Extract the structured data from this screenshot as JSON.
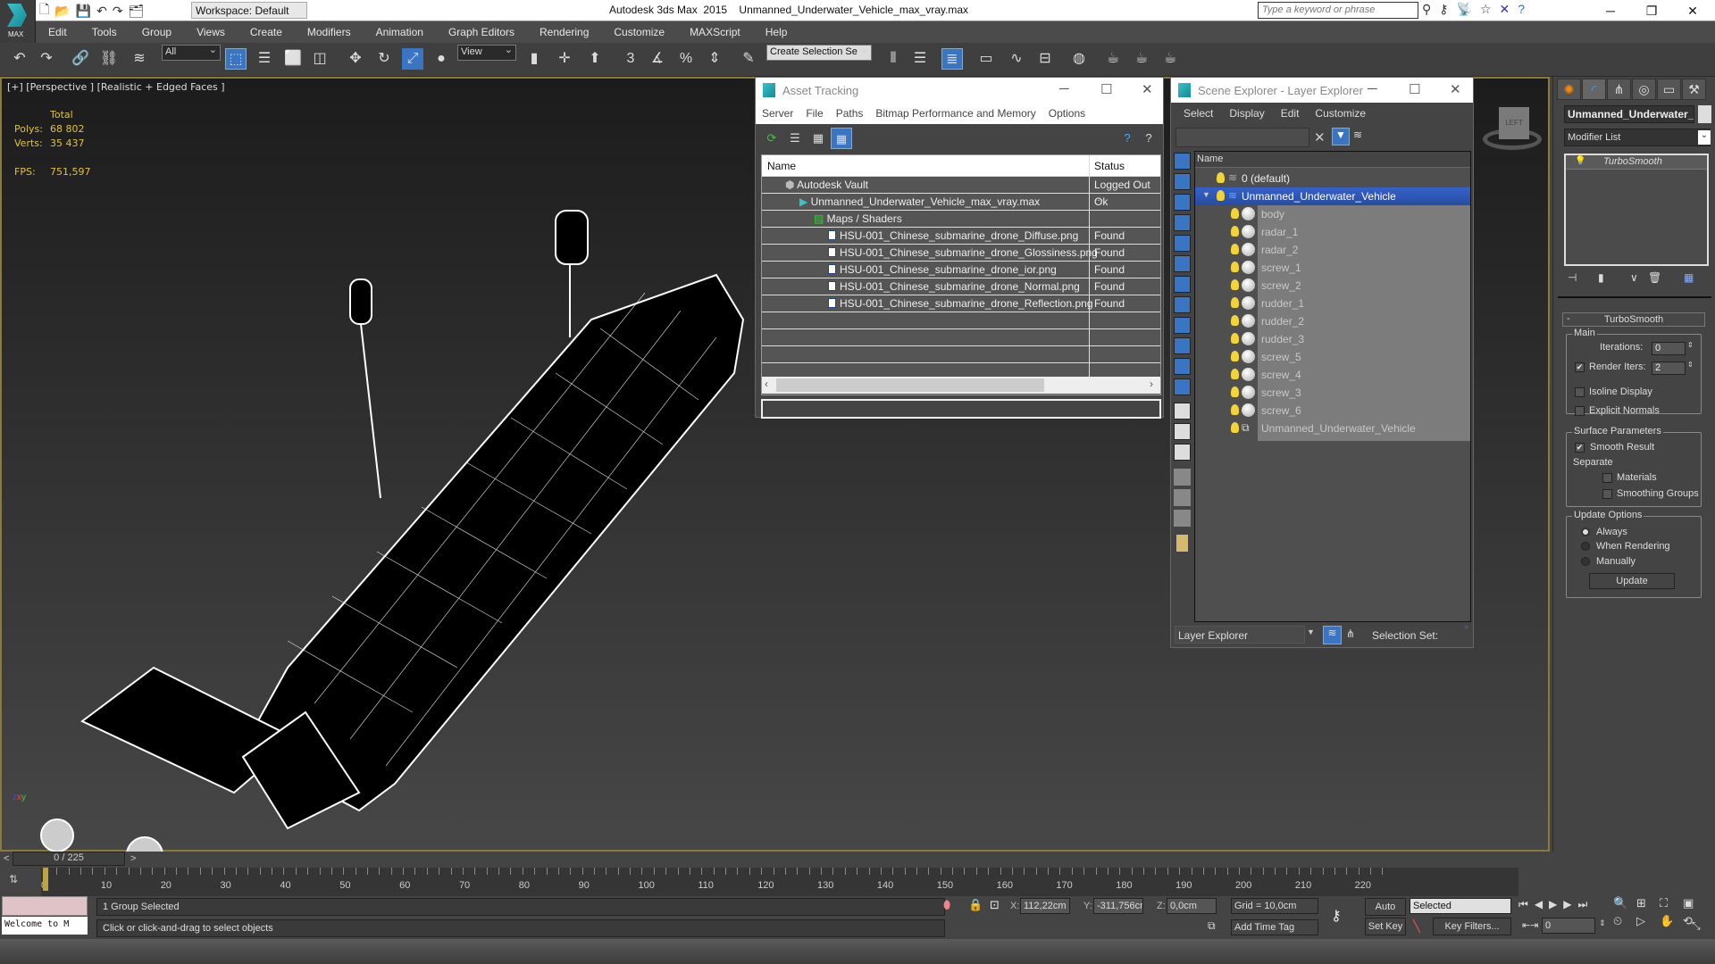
{
  "app": {
    "title": "Autodesk 3ds Max  2015    Unmanned_Underwater_Vehicle_max_vray.max",
    "logo_label": "MAX",
    "workspace": "Workspace: Default",
    "search_placeholder": "Type a keyword or phrase"
  },
  "menu": [
    "Edit",
    "Tools",
    "Group",
    "Views",
    "Create",
    "Modifiers",
    "Animation",
    "Graph Editors",
    "Rendering",
    "Customize",
    "MAXScript",
    "Help"
  ],
  "toolbar": {
    "filter_select": "All",
    "ref_coord": "View",
    "selection_set": "Create Selection Se"
  },
  "viewport": {
    "label": "[+] [Perspective ] [Realistic + Edged Faces ]",
    "stats_header": "Total",
    "polys_label": "Polys:",
    "polys": "68 802",
    "verts_label": "Verts:",
    "verts": "35 437",
    "fps_label": "FPS:",
    "fps": "751,597",
    "viewcube_face": "LEFT"
  },
  "asset_tracking": {
    "title": "Asset Tracking",
    "menu": [
      "Server",
      "File",
      "Paths",
      "Bitmap Performance and Memory",
      "Options"
    ],
    "columns": [
      "Name",
      "Status"
    ],
    "rows": [
      {
        "name": "Autodesk Vault",
        "status": "Logged Out ...",
        "level": 0
      },
      {
        "name": "Unmanned_Underwater_Vehicle_max_vray.max",
        "status": "Ok",
        "level": 1
      },
      {
        "name": "Maps / Shaders",
        "status": "",
        "level": 2
      },
      {
        "name": "HSU-001_Chinese_submarine_drone_Diffuse.png",
        "status": "Found",
        "level": 3
      },
      {
        "name": "HSU-001_Chinese_submarine_drone_Glossiness.png",
        "status": "Found",
        "level": 3
      },
      {
        "name": "HSU-001_Chinese_submarine_drone_ior.png",
        "status": "Found",
        "level": 3
      },
      {
        "name": "HSU-001_Chinese_submarine_drone_Normal.png",
        "status": "Found",
        "level": 3
      },
      {
        "name": "HSU-001_Chinese_submarine_drone_Reflection.png",
        "status": "Found",
        "level": 3
      }
    ]
  },
  "scene_explorer": {
    "title": "Scene Explorer - Layer Explorer",
    "menu": [
      "Select",
      "Display",
      "Edit",
      "Customize"
    ],
    "column": "Name",
    "layers": [
      {
        "name": "0 (default)",
        "selected": false
      },
      {
        "name": "Unmanned_Underwater_Vehicle",
        "selected": true
      }
    ],
    "objects": [
      "body",
      "radar_1",
      "radar_2",
      "screw_1",
      "screw_2",
      "rudder_1",
      "rudder_2",
      "rudder_3",
      "screw_5",
      "screw_4",
      "screw_3",
      "screw_6",
      "Unmanned_Underwater_Vehicle"
    ],
    "footer_dropdown": "Layer Explorer",
    "selection_set_label": "Selection Set:"
  },
  "command_panel": {
    "object_name": "Unmanned_Underwater_",
    "modifier_list": "Modifier List",
    "stack": [
      "TurboSmooth"
    ],
    "rollout_title": "TurboSmooth",
    "main_group": "Main",
    "iterations_label": "Iterations:",
    "iterations": "0",
    "render_iters_label": "Render Iters:",
    "render_iters": "2",
    "render_iters_checked": true,
    "isoline_label": "Isoline Display",
    "explicit_label": "Explicit Normals",
    "surface_group": "Surface Parameters",
    "smooth_result_label": "Smooth Result",
    "smooth_result_checked": true,
    "separate_label": "Separate",
    "materials_label": "Materials",
    "smoothing_groups_label": "Smoothing Groups",
    "update_group": "Update Options",
    "update_options": [
      "Always",
      "When Rendering",
      "Manually"
    ],
    "update_selected": "Always",
    "update_button": "Update"
  },
  "timeline": {
    "slider": "0 / 225",
    "ticks": [
      0,
      10,
      20,
      30,
      40,
      50,
      60,
      70,
      80,
      90,
      100,
      110,
      120,
      130,
      140,
      150,
      160,
      170,
      180,
      190,
      200,
      210,
      220
    ],
    "max_frame": 225
  },
  "status": {
    "selection": "1 Group Selected",
    "prompt": "Click or click-and-drag to select objects",
    "welcome": "Welcome to M",
    "x_label": "X:",
    "x": "112,22cm",
    "y_label": "Y:",
    "y": "-311,756cm",
    "z_label": "Z:",
    "z": "0,0cm",
    "grid": "Grid = 10,0cm",
    "add_time_tag": "Add Time Tag",
    "auto_key": "Auto Key",
    "set_key": "Set Key",
    "key_mode": "Selected",
    "key_filters": "Key Filters...",
    "frame": "0"
  }
}
